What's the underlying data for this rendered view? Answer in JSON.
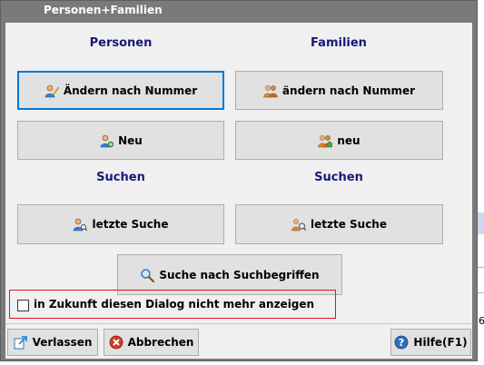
{
  "window": {
    "title": "Personen+Familien"
  },
  "personen": {
    "heading": "Personen",
    "edit_by_number": "Ändern nach Nummer",
    "new": "Neu"
  },
  "familien": {
    "heading": "Familien",
    "edit_by_number": "ändern nach Nummer",
    "new": "neu"
  },
  "search": {
    "heading_left": "Suchen",
    "heading_right": "Suchen",
    "last_search_persons": "letzte Suche",
    "last_search_families": "letzte Suche",
    "by_keywords": "Suche nach Suchbegriffen"
  },
  "option": {
    "dont_show_again": "in Zukunft diesen Dialog nicht mehr anzeigen",
    "checked": false
  },
  "footer": {
    "leave": "Verlassen",
    "cancel": "Abbrechen",
    "help": "Hilfe(F1)"
  },
  "background": {
    "edge_char": "6"
  },
  "colors": {
    "heading": "#17177a",
    "focus_border": "#0078d7",
    "highlight_box": "#e0141e",
    "title_bar": "#7a7a7a"
  }
}
